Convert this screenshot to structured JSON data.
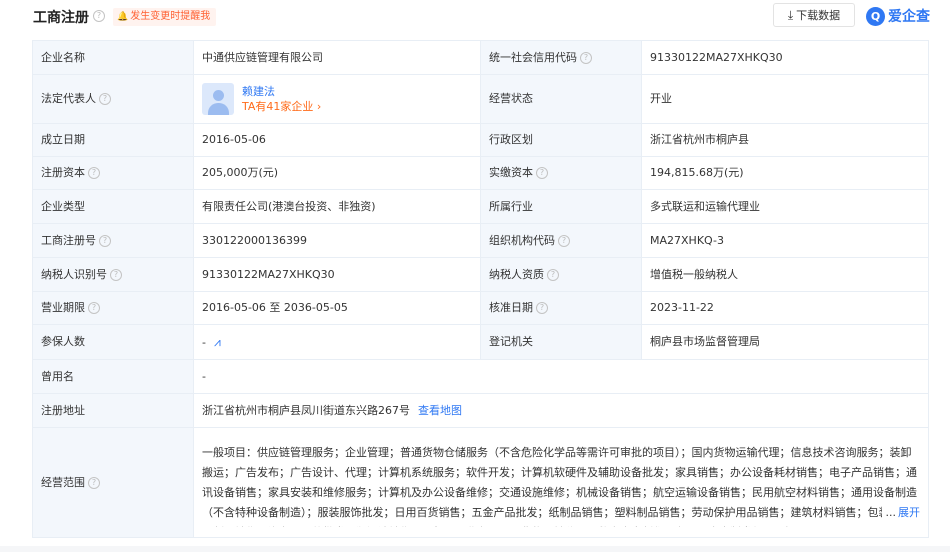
{
  "header": {
    "title": "工商注册",
    "help": "?",
    "alert": "发生变更时提醒我",
    "download": "下载数据",
    "brand_logo": "Q",
    "brand_name": "爱企查"
  },
  "rows": {
    "company_name": {
      "label": "企业名称",
      "value": "中通供应链管理有限公司"
    },
    "credit_code": {
      "label": "统一社会信用代码",
      "value": "91330122MA27XHKQ30"
    },
    "legal_rep": {
      "label": "法定代表人",
      "name": "赖建法",
      "companies": "TA有41家企业"
    },
    "status": {
      "label": "经营状态",
      "value": "开业"
    },
    "founded": {
      "label": "成立日期",
      "value": "2016-05-06"
    },
    "region": {
      "label": "行政区划",
      "value": "浙江省杭州市桐庐县"
    },
    "reg_capital": {
      "label": "注册资本",
      "value": "205,000万(元)"
    },
    "paid_capital": {
      "label": "实缴资本",
      "value": "194,815.68万(元)"
    },
    "company_type": {
      "label": "企业类型",
      "value": "有限责任公司(港澳台投资、非独资)"
    },
    "industry": {
      "label": "所属行业",
      "value": "多式联运和运输代理业"
    },
    "reg_number": {
      "label": "工商注册号",
      "value": "330122000136399"
    },
    "org_code": {
      "label": "组织机构代码",
      "value": "MA27XHKQ-3"
    },
    "taxpayer_id": {
      "label": "纳税人识别号",
      "value": "91330122MA27XHKQ30"
    },
    "taxpayer_type": {
      "label": "纳税人资质",
      "value": "增值税一般纳税人"
    },
    "term": {
      "label": "营业期限",
      "value": "2016-05-06 至 2036-05-05"
    },
    "approve_date": {
      "label": "核准日期",
      "value": "2023-11-22"
    },
    "insured": {
      "label": "参保人数",
      "value": "-"
    },
    "authority": {
      "label": "登记机关",
      "value": "桐庐县市场监督管理局"
    },
    "former_name": {
      "label": "曾用名",
      "value": "-"
    },
    "address": {
      "label": "注册地址",
      "value": "浙江省杭州市桐庐县凤川街道东兴路267号",
      "link": "查看地图"
    },
    "scope": {
      "label": "经营范围",
      "value": "一般项目：供应链管理服务；企业管理；普通货物仓储服务（不含危险化学品等需许可审批的项目）；国内货物运输代理；信息技术咨询服务；装卸搬运；广告发布；广告设计、代理；计算机系统服务；软件开发；计算机软硬件及辅助设备批发；家具销售；办公设备耗材销售；电子产品销售；通讯设备销售；家具安装和维修服务；计算机及办公设备维修；交通设施维修；机械设备销售；航空运输设备销售；民用航空材料销售；通用设备制造（不含特种设备制造）；服装服饰批发；日用百货销售；五金产品批发；纸制品销售；塑料制品销售；劳动保护用品销售；建筑材料销售；包装材料及制品销售；汽车零配件批发；润滑油销售；无船承运业务；国际货物运输代理；数字内容制作服务（不含出版发行）（除",
      "dots": "...",
      "expand": "展开"
    }
  }
}
